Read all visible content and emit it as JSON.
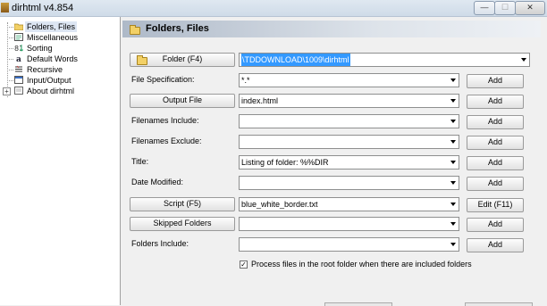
{
  "window": {
    "title": "dirhtml v4.854",
    "min": "—",
    "max": "☐",
    "close": "✕"
  },
  "tree": {
    "items": [
      {
        "label": "Folders, Files",
        "icon": "folder-icon"
      },
      {
        "label": "Miscellaneous",
        "icon": "misc-icon"
      },
      {
        "label": "Sorting",
        "icon": "sort-icon"
      },
      {
        "label": "Default Words",
        "icon": "words-icon"
      },
      {
        "label": "Recursive",
        "icon": "recursive-icon"
      },
      {
        "label": "Input/Output",
        "icon": "io-icon"
      },
      {
        "label": "About dirhtml",
        "icon": "about-icon"
      }
    ],
    "expander": "+"
  },
  "panel": {
    "title": "Folders, Files",
    "folder_button": "Folder (F4)",
    "folder_value": "\\TDDOWNLOAD\\1009\\dirhtml",
    "file_spec_label": "File Specification:",
    "file_spec_value": "*.*",
    "output_button": "Output File",
    "output_value": "index.html",
    "include_label": "Filenames Include:",
    "include_value": "",
    "exclude_label": "Filenames Exclude:",
    "exclude_value": "",
    "title_label": "Title:",
    "title_value": "Listing of folder: %%DIR",
    "date_label": "Date Modified:",
    "date_value": "",
    "script_button": "Script (F5)",
    "script_value": "blue_white_border.txt",
    "skipped_button": "Skipped Folders",
    "skipped_value": "",
    "folders_include_label": "Folders Include:",
    "folders_include_value": "",
    "add_label": "Add",
    "edit_label": "Edit (F11)",
    "checkbox_label": "Process files in the root folder when there are included folders",
    "checkbox_mark": "✓"
  }
}
